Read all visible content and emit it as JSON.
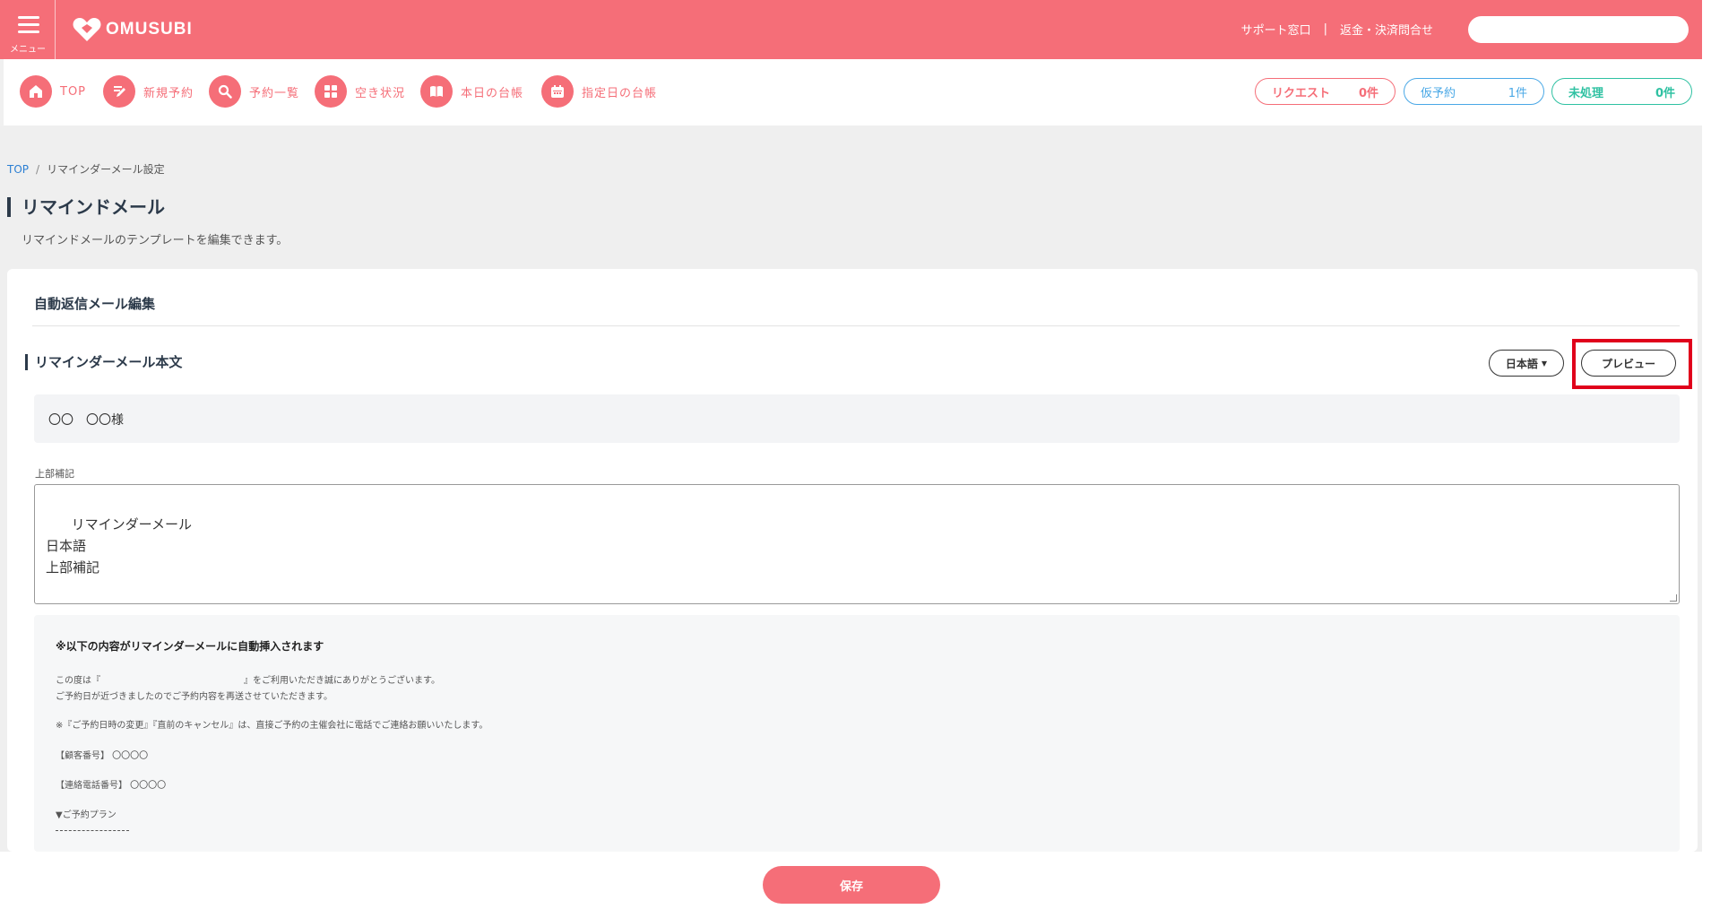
{
  "header": {
    "menu_label": "メニュー",
    "logo_text": "OMUSUBI",
    "support_link": "サポート窓口",
    "separator": "|",
    "refund_link": "返金・決済問合せ",
    "search_value": ""
  },
  "nav": {
    "items": [
      {
        "label": "TOP",
        "icon": "home-icon"
      },
      {
        "label": "新規予約",
        "icon": "edit-icon"
      },
      {
        "label": "予約一覧",
        "icon": "search-icon"
      },
      {
        "label": "空き状況",
        "icon": "grid-icon"
      },
      {
        "label": "本日の台帳",
        "icon": "book-icon"
      },
      {
        "label": "指定日の台帳",
        "icon": "calendar-icon"
      }
    ],
    "status": [
      {
        "label": "リクエスト",
        "count": "0件"
      },
      {
        "label": "仮予約",
        "count": "1件"
      },
      {
        "label": "未処理",
        "count": "0件"
      }
    ]
  },
  "breadcrumb": {
    "home": "TOP",
    "separator": "/",
    "current": "リマインダーメール設定"
  },
  "page": {
    "title": "リマインドメール",
    "description": "リマインドメールのテンプレートを編集できます。"
  },
  "card": {
    "title": "自動返信メール編集",
    "section_title": "リマインダーメール本文",
    "language_button": "日本語",
    "preview_button": "プレビュー",
    "recipient_name": "〇〇　〇〇様",
    "top_note_label": "上部補記",
    "top_note_value": "リマインダーメール\n日本語\n上部補記",
    "insert": {
      "title": "※以下の内容がリマインダーメールに自動挿入されます",
      "line1_prefix": "この度は『",
      "line1_suffix": "』をご利用いただき誠にありがとうございます。",
      "line2": "ご予約日が近づきましたのでご予約内容を再送させていただきます。",
      "line3": "※『ご予約日時の変更』『直前のキャンセル』は、直接ご予約の主催会社に電話でご連絡お願いいたします。",
      "customer_no": "【顧客番号】 〇〇〇〇",
      "phone_no": "【連絡電話番号】 〇〇〇〇",
      "plan": "▼ご予約プラン"
    }
  },
  "footer": {
    "save_button": "保存"
  },
  "colors": {
    "brand": "#f56e78",
    "blue": "#4aa8e6",
    "green": "#2fc1a2",
    "highlight": "#e0001b"
  }
}
